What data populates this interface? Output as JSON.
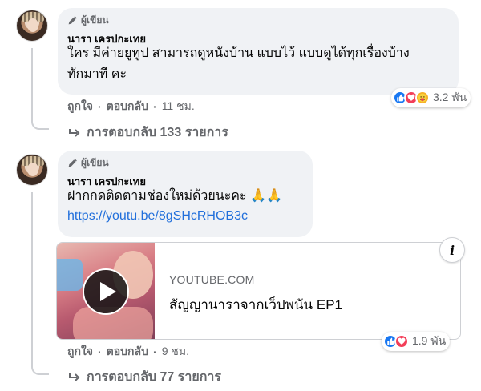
{
  "comments": [
    {
      "role_label": "ผู้เขียน",
      "author": "นารา เครปกะเทย",
      "text": "ใคร มีค่ายยูทูป สามารถดูหนังบ้าน แบบไว้ แบบดูได้ทุกเรื่องบ้าง\nทักมาที คะ",
      "reaction_count": "3.2 พัน",
      "reactions": [
        "like-icon",
        "love-icon",
        "care-icon"
      ],
      "like_label": "ถูกใจ",
      "reply_label": "ตอบกลับ",
      "time": "11 ชม.",
      "replies_label": "การตอบกลับ 133 รายการ"
    },
    {
      "role_label": "ผู้เขียน",
      "author": "นารา เครปกะเทย",
      "text": "ฝากกดติดตามช่องใหม่ด้วยนะคะ 🙏🙏",
      "link": "https://youtu.be/8gSHcRHOB3c",
      "reaction_count": "1.9 พัน",
      "reactions": [
        "like-icon",
        "love-icon"
      ],
      "like_label": "ถูกใจ",
      "reply_label": "ตอบกลับ",
      "time": "9 ชม.",
      "replies_label": "การตอบกลับ 77 รายการ",
      "preview": {
        "domain": "YOUTUBE.COM",
        "title": "สัญญานาราจากเว็ปพนัน EP1",
        "info_label": "i"
      }
    }
  ],
  "colors": {
    "bubble": "#f0f2f5",
    "link": "#216fdb",
    "like": "#1877f2",
    "love": "#f33e58",
    "care": "#f7b125",
    "muted": "#65676b"
  }
}
